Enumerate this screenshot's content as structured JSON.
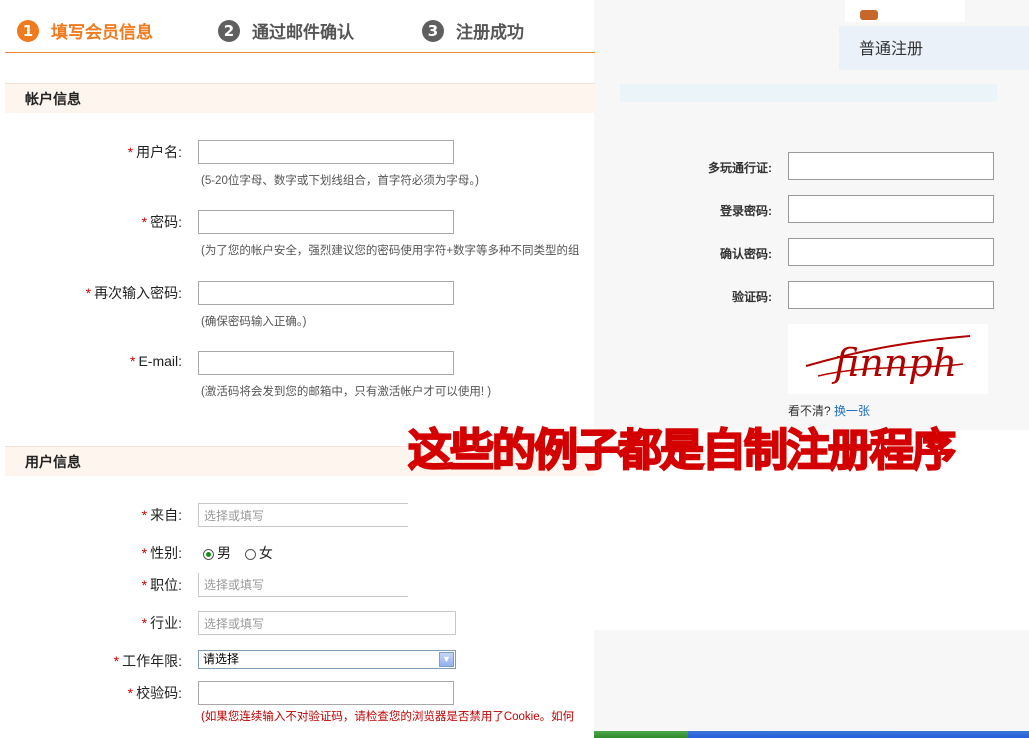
{
  "steps": [
    {
      "num": "1",
      "label": "填写会员信息",
      "active": true
    },
    {
      "num": "2",
      "label": "通过邮件确认",
      "active": false
    },
    {
      "num": "3",
      "label": "注册成功",
      "active": false
    }
  ],
  "account_section": {
    "title": "帐户信息",
    "username": {
      "label": "用户名:",
      "hint": "(5-20位字母、数字或下划线组合，首字符必须为字母。)"
    },
    "password": {
      "label": "密码:",
      "hint": "(为了您的帐户安全，强烈建议您的密码使用字符+数字等多种不同类型的组"
    },
    "password_confirm": {
      "label": "再次输入密码:",
      "hint": "(确保密码输入正确。)"
    },
    "email": {
      "label": "E-mail:",
      "hint": "(激活码将会发到您的邮箱中，只有激活帐户才可以使用! )"
    }
  },
  "user_section": {
    "title": "用户信息",
    "from": {
      "label": "来自:",
      "placeholder": "选择或填写"
    },
    "gender": {
      "label": "性别:",
      "options": [
        "男",
        "女"
      ],
      "selected": "男"
    },
    "position": {
      "label": "职位:",
      "placeholder": "选择或填写"
    },
    "industry": {
      "label": "行业:",
      "placeholder": "选择或填写"
    },
    "work_years": {
      "label": "工作年限:",
      "selected": "请选择"
    },
    "verify_code": {
      "label": "校验码:",
      "hint": "(如果您连续输入不对验证码，请检查您的浏览器是否禁用了Cookie。如何"
    }
  },
  "required_mark": "*",
  "right_panel": {
    "tab_label": "普通注册",
    "fields": [
      {
        "label": "多玩通行证:"
      },
      {
        "label": "登录密码:"
      },
      {
        "label": "确认密码:"
      },
      {
        "label": "验证码:"
      }
    ],
    "captcha_text": "finnph",
    "refresh_prompt": "看不清?",
    "refresh_link": "换一张"
  },
  "overlay_text": "这些的例子都是自制注册程序",
  "colors": {
    "accent": "#f07a1e",
    "required": "#d40000",
    "link": "#1a6fc4",
    "section_bg": "#fdf5ee"
  }
}
